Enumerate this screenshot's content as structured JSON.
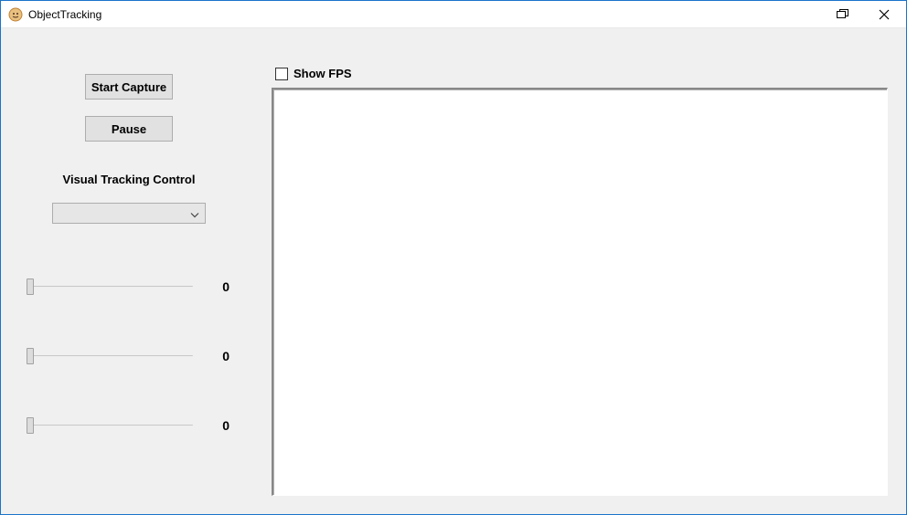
{
  "window": {
    "title": "ObjectTracking"
  },
  "sidebar": {
    "start_label": "Start Capture",
    "pause_label": "Pause",
    "section_label": "Visual Tracking Control",
    "combo_selected": ""
  },
  "sliders": [
    {
      "value": "0"
    },
    {
      "value": "0"
    },
    {
      "value": "0"
    }
  ],
  "main": {
    "show_fps_label": "Show FPS",
    "show_fps_checked": false
  }
}
